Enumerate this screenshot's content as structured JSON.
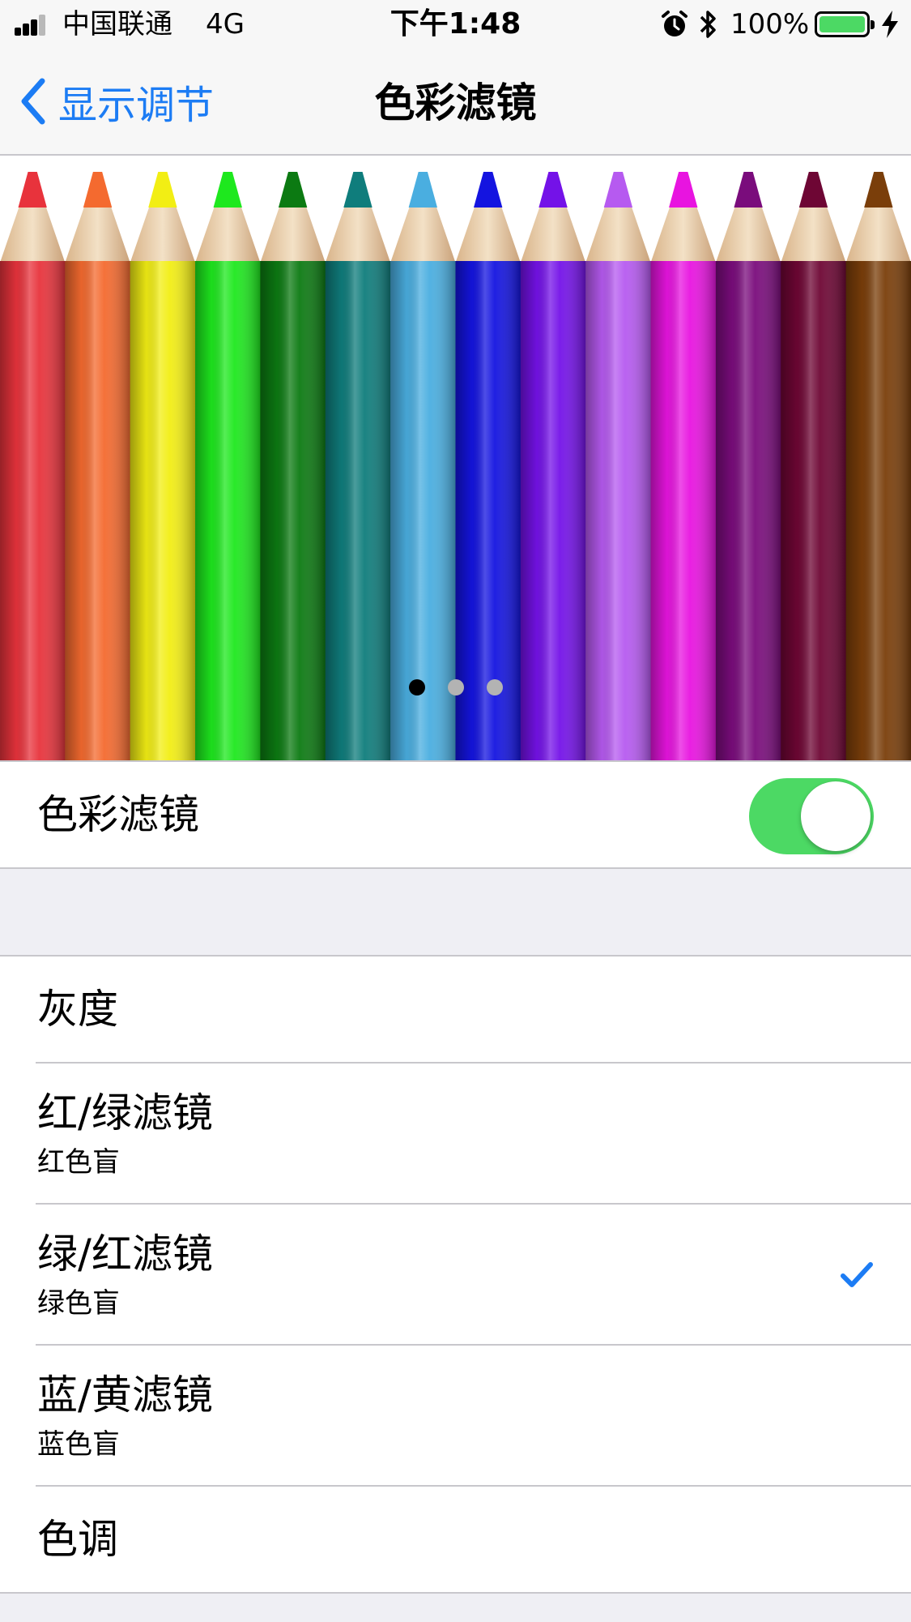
{
  "status_bar": {
    "carrier": "中国联通",
    "network": "4G",
    "time": "下午1:48",
    "battery_percent": "100%",
    "battery_level": 1.0,
    "signal_bars": 3,
    "icons": [
      "signal-icon",
      "alarm-icon",
      "bluetooth-icon",
      "battery-icon",
      "charging-icon"
    ]
  },
  "nav": {
    "back_label": "显示调节",
    "title": "色彩滤镜"
  },
  "preview": {
    "pencil_colors": [
      "#e8333c",
      "#f46a2f",
      "#f2ee14",
      "#1ee81e",
      "#0c7a12",
      "#0f7d7c",
      "#4aaee0",
      "#1414e0",
      "#7412e8",
      "#b65af0",
      "#e814e0",
      "#7a0c7c",
      "#6e0634",
      "#7a3e0a"
    ],
    "pages": 3,
    "current_page": 1
  },
  "toggle_section": {
    "label": "色彩滤镜",
    "enabled": true,
    "accent": "#4cd964"
  },
  "filters": [
    {
      "title": "灰度",
      "subtitle": "",
      "selected": false
    },
    {
      "title": "红/绿滤镜",
      "subtitle": "红色盲",
      "selected": false
    },
    {
      "title": "绿/红滤镜",
      "subtitle": "绿色盲",
      "selected": true
    },
    {
      "title": "蓝/黄滤镜",
      "subtitle": "蓝色盲",
      "selected": false
    },
    {
      "title": "色调",
      "subtitle": "",
      "selected": false
    }
  ],
  "colors": {
    "tint": "#1c7cf4",
    "background": "#efeff4"
  }
}
